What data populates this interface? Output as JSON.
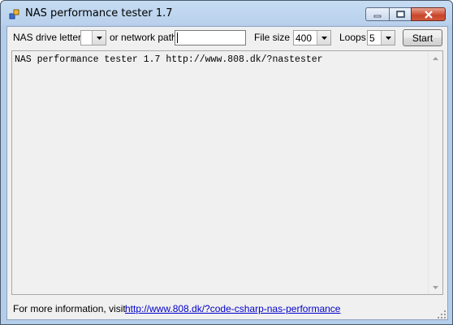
{
  "window": {
    "title": "NAS performance tester 1.7"
  },
  "toolbar": {
    "drive_label": "NAS drive letter",
    "drive_value": "",
    "path_label": "or network path",
    "path_value": "",
    "filesize_label": "File size",
    "filesize_value": "400",
    "loops_label": "Loops",
    "loops_value": "5",
    "start_label": "Start"
  },
  "output": {
    "text": "NAS performance tester 1.7 http://www.808.dk/?nastester"
  },
  "footer": {
    "info_text": "For more information, visit",
    "link_text": "http://www.808.dk/?code-csharp-nas-performance"
  },
  "colors": {
    "link": "#0000cc",
    "close_button": "#c9452a"
  },
  "icons": [
    "app-icon",
    "minimize-icon",
    "maximize-icon",
    "close-icon",
    "chevron-down-icon",
    "scroll-up-icon",
    "scroll-down-icon",
    "resize-grip-icon"
  ]
}
